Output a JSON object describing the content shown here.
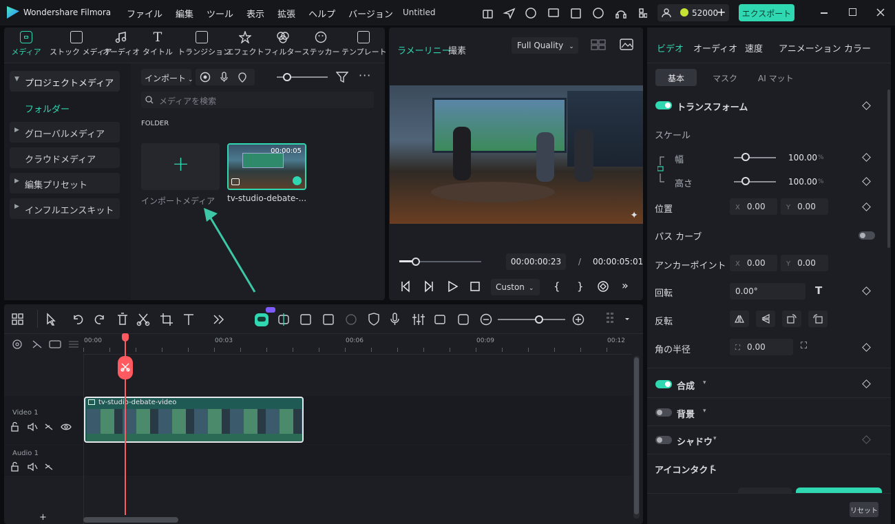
{
  "app": {
    "name": "Wondershare Filmora",
    "doc_title": "Untitled"
  },
  "menu": [
    "ファイル",
    "編集",
    "ツール",
    "表示",
    "拡張",
    "ヘルプ",
    "バージョン"
  ],
  "header": {
    "credits": "52000",
    "export_label": "エクスポート"
  },
  "media_tabs": [
    {
      "label": "メディア",
      "icon": "media-icon"
    },
    {
      "label": "ストック メディア",
      "icon": "stock-media-icon"
    },
    {
      "label": "オーディオ",
      "icon": "audio-icon"
    },
    {
      "label": "タイトル",
      "icon": "title-icon"
    },
    {
      "label": "トランジション",
      "icon": "transition-icon"
    },
    {
      "label": "エフェクト",
      "icon": "effect-icon"
    },
    {
      "label": "フィルター",
      "icon": "filter-icon"
    },
    {
      "label": "ステッカー",
      "icon": "sticker-icon"
    },
    {
      "label": "テンプレート",
      "icon": "template-icon"
    }
  ],
  "sidebar": {
    "project_media": "プロジェクトメディア",
    "folder": "フォルダー",
    "global_media": "グローバルメディア",
    "cloud_media": "クラウドメディア",
    "edit_presets": "編集プリセット",
    "influencer_kit": "インフルエンスキット"
  },
  "library": {
    "import_label": "インポート",
    "search_placeholder": "メディアを検索",
    "folder_heading": "FOLDER",
    "import_media_label": "インポートメディア",
    "clip_name": "tv-studio-debate-...",
    "clip_duration": "00:00:05"
  },
  "player": {
    "tab_preview": "ラメーリニー",
    "tab_edit": "撮素",
    "quality": "Full Quality",
    "current_time": "00:00:00:23",
    "separator": "/",
    "total_time": "00:00:05:01",
    "zoom": "Custon",
    "progress": 0.2
  },
  "timeline": {
    "ruler": [
      "00:00",
      "00:03",
      "00:06",
      "00:09",
      "00:12"
    ],
    "video_track": "Video 1",
    "audio_track": "Audio 1",
    "clip_title": "tv-studio-debate-video"
  },
  "properties": {
    "tabs": [
      "ビデオ",
      "オーディオ",
      "速度",
      "アニメーション",
      "カラー"
    ],
    "subtabs": [
      "基本",
      "マスク",
      "AI マット"
    ],
    "transform": "トランスフォーム",
    "scale": "スケール",
    "width_label": "幅",
    "width_value": "100.00",
    "height_label": "高さ",
    "height_value": "100.00",
    "percent": "%",
    "position": "位置",
    "x_label": "X",
    "x_value": "0.00",
    "y_label": "Y",
    "y_value": "0.00",
    "path_curve": "パス カーブ",
    "anchor": "アンカーポイント",
    "anchor_x": "0.00",
    "anchor_y": "0.00",
    "rotate": "回転",
    "rotate_value": "0.00°",
    "flip": "反転",
    "corner_radius": "角の半径",
    "corner_value": "0.00",
    "composite": "合成",
    "background": "背景",
    "shadow": "シャドウ",
    "eye_contact": "アイコンタクト",
    "reset": "リセット"
  },
  "colors": {
    "accent": "#2fd8b0",
    "playhead": "#ff5a5f",
    "clip": "#1f5a54"
  }
}
